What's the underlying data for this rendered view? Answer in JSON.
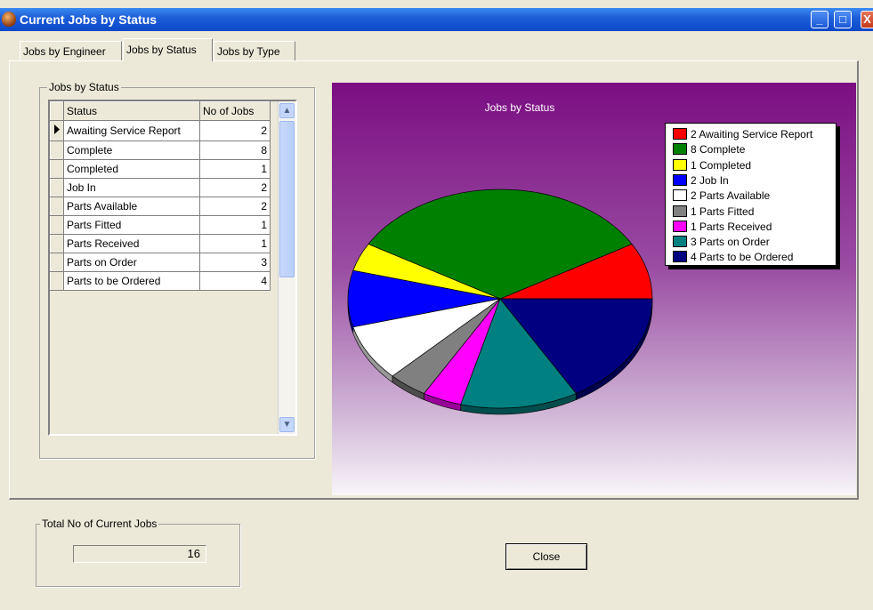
{
  "window": {
    "title": "Current Jobs by Status",
    "controls": {
      "minimize": "_",
      "maximize": "□",
      "close": "X"
    }
  },
  "tabs": [
    {
      "label": "Jobs by Engineer",
      "active": false
    },
    {
      "label": "Jobs by Status",
      "active": true
    },
    {
      "label": "Jobs by Type",
      "active": false
    }
  ],
  "status_group": {
    "label": "Jobs by Status",
    "columns": [
      "Status",
      "No of Jobs"
    ],
    "rows": [
      {
        "status": "Awaiting Service Report",
        "count": "2",
        "current": true
      },
      {
        "status": "Complete",
        "count": "8"
      },
      {
        "status": "Completed",
        "count": "1"
      },
      {
        "status": "Job In",
        "count": "2"
      },
      {
        "status": "Parts Available",
        "count": "2"
      },
      {
        "status": "Parts Fitted",
        "count": "1"
      },
      {
        "status": "Parts Received",
        "count": "1"
      },
      {
        "status": "Parts on Order",
        "count": "3"
      },
      {
        "status": "Parts to be Ordered",
        "count": "4"
      }
    ]
  },
  "chart_data": {
    "type": "pie",
    "title": "Jobs by Status",
    "legend_position": "top-right",
    "categories": [
      "Awaiting Service Report",
      "Complete",
      "Completed",
      "Job In",
      "Parts Available",
      "Parts Fitted",
      "Parts Received",
      "Parts on Order",
      "Parts to be Ordered"
    ],
    "values": [
      2,
      8,
      1,
      2,
      2,
      1,
      1,
      3,
      4
    ],
    "legend": [
      "2 Awaiting Service Report",
      "8 Complete",
      "1 Completed",
      "2 Job In",
      "2 Parts Available",
      "1 Parts Fitted",
      "1 Parts Received",
      "3 Parts on Order",
      "4 Parts to be Ordered"
    ],
    "colors": [
      "#FF0000",
      "#008000",
      "#FFFF00",
      "#0000FF",
      "#FFFFFF",
      "#808080",
      "#FF00FF",
      "#008080",
      "#000080"
    ]
  },
  "total_group": {
    "label": "Total No of Current Jobs",
    "value": "16"
  },
  "close_button": {
    "label": "Close"
  }
}
